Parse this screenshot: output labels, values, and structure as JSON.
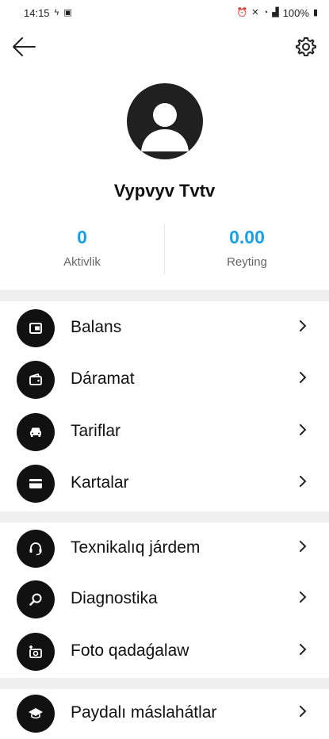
{
  "status_bar": {
    "time": "14:15",
    "battery": "100%"
  },
  "profile": {
    "name": "Vypvyv Tvtv"
  },
  "stats": [
    {
      "value": "0",
      "label": "Aktivlik"
    },
    {
      "value": "0.00",
      "label": "Reyting"
    }
  ],
  "menu": {
    "group1": [
      {
        "label": "Balans",
        "icon": "wallet-icon"
      },
      {
        "label": "Dáramat",
        "icon": "purse-icon"
      },
      {
        "label": "Tariflar",
        "icon": "car-icon"
      },
      {
        "label": "Kartalar",
        "icon": "credit-card-icon"
      }
    ],
    "group2": [
      {
        "label": "Texnikalıq járdem",
        "icon": "headset-icon"
      },
      {
        "label": "Diagnostika",
        "icon": "magnifier-icon"
      },
      {
        "label": "Foto qadaǵalaw",
        "icon": "add-photo-icon"
      }
    ],
    "group3": [
      {
        "label": "Paydalı máslahátlar",
        "icon": "graduation-cap-icon"
      }
    ]
  },
  "colors": {
    "accent": "#1aa0e6",
    "icon_bg": "#111111",
    "separator": "#efefef"
  }
}
